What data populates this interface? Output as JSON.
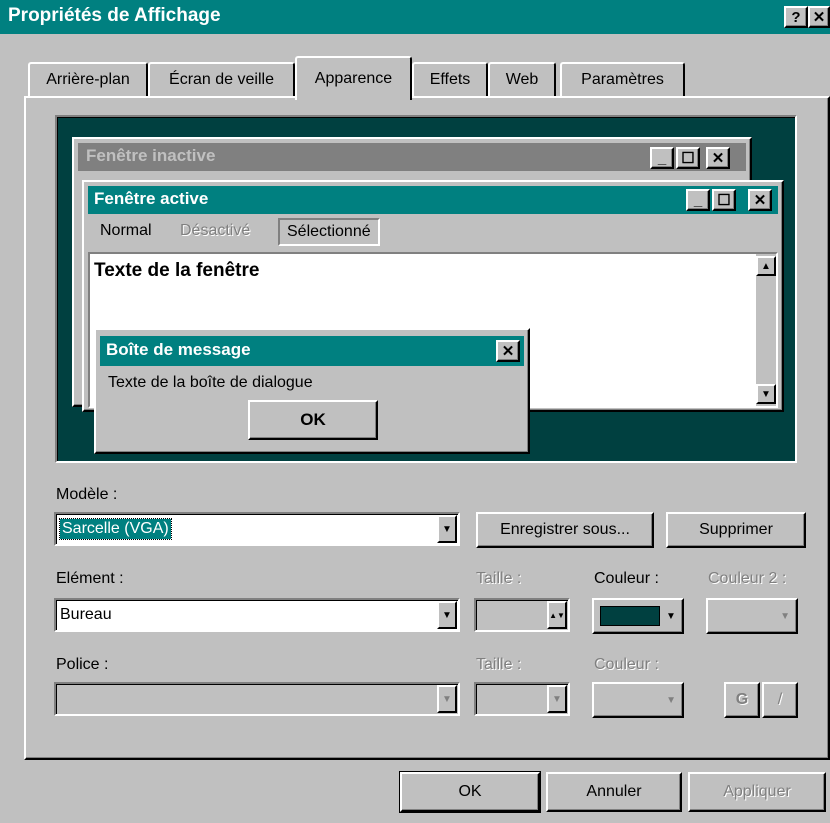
{
  "window": {
    "title": "Propriétés de Affichage",
    "help_btn": "?",
    "close_btn": "✕"
  },
  "tabs": [
    {
      "label": "Arrière-plan"
    },
    {
      "label": "Écran de veille"
    },
    {
      "label": "Apparence"
    },
    {
      "label": "Effets"
    },
    {
      "label": "Web"
    },
    {
      "label": "Paramètres"
    }
  ],
  "preview": {
    "inactive_title": "Fenêtre inactive",
    "active_title": "Fenêtre active",
    "menu_normal": "Normal",
    "menu_disabled": "Désactivé",
    "menu_selected": "Sélectionné",
    "window_text": "Texte de la fenêtre",
    "msgbox_title": "Boîte de message",
    "msgbox_text": "Texte de la boîte de dialogue",
    "msgbox_ok": "OK",
    "desktop_color": "#004040"
  },
  "modele": {
    "label": "Modèle :",
    "value": "Sarcelle (VGA)",
    "save_as": "Enregistrer sous...",
    "delete": "Supprimer"
  },
  "element": {
    "label": "Elément :",
    "value": "Bureau",
    "size_label": "Taille :",
    "color_label": "Couleur :",
    "color2_label": "Couleur 2 :",
    "color_value": "#004040"
  },
  "police": {
    "label": "Police :",
    "size_label": "Taille :",
    "color_label": "Couleur :",
    "bold_btn": "G",
    "italic_btn": "/"
  },
  "footer": {
    "ok": "OK",
    "cancel": "Annuler",
    "apply": "Appliquer"
  }
}
